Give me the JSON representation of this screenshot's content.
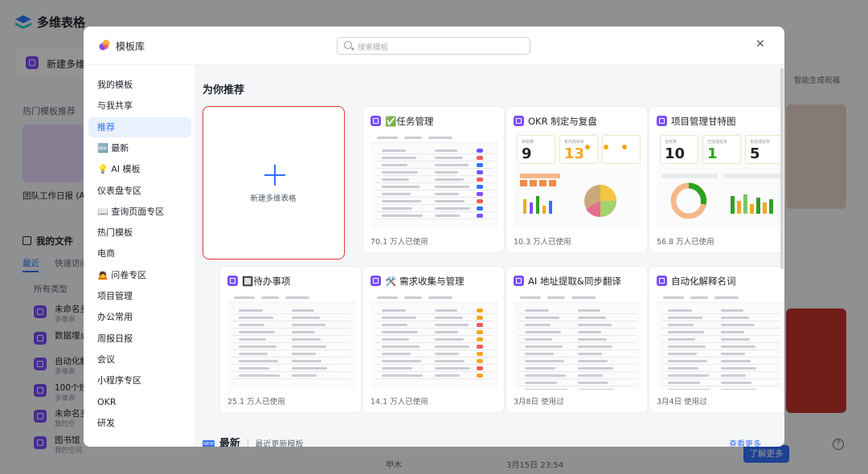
{
  "app": {
    "name": "多维表格",
    "new_table": "新建多维",
    "hot_templates": "热门模板推荐",
    "team_report": "团队工作日报 (A",
    "my_files": "我的文件",
    "tab_recent": "最近",
    "tab_quick": "快速访问",
    "filter_all_types": "所有类型",
    "files": [
      {
        "name": "未命名多",
        "sub": "多维表"
      },
      {
        "name": "数据埋点",
        "sub": ""
      },
      {
        "name": "自动化解",
        "sub": "多维表"
      },
      {
        "name": "100个短",
        "sub": "多维表"
      },
      {
        "name": "未命名多",
        "sub": "我的空"
      },
      {
        "name": "图书馆",
        "sub": "我的空间"
      }
    ],
    "right_link": "智能生成祝福",
    "bottom_owner": "甲木",
    "bottom_time": "3月15日 23:54",
    "learn_more": "了解更多"
  },
  "modal": {
    "title": "模板库",
    "search_placeholder": "搜索模板",
    "close_glyph": "✕",
    "nav": [
      {
        "label": "我的模板"
      },
      {
        "label": "与我共享"
      },
      {
        "label": "推荐",
        "active": true
      },
      {
        "label": "🆕 最新"
      },
      {
        "label": "💡 AI 模板"
      },
      {
        "label": "仪表盘专区"
      },
      {
        "label": "📖 查询页面专区"
      },
      {
        "label": "热门模板"
      },
      {
        "label": "电商"
      },
      {
        "label": "🙇 问卷专区"
      },
      {
        "label": "项目管理"
      },
      {
        "label": "办公常用"
      },
      {
        "label": "周报日报"
      },
      {
        "label": "会议"
      },
      {
        "label": "小程序专区"
      },
      {
        "label": "OKR"
      },
      {
        "label": "研发"
      }
    ],
    "section_title": "为你推荐",
    "new_card_label": "新建多维表格",
    "cards": [
      {
        "title": "✅任务管理",
        "footer": "70.1 万人已使用"
      },
      {
        "title": "OKR 制定与复盘",
        "footer": "10.3 万人已使用"
      },
      {
        "title": "项目管理甘特图",
        "footer": "56.8 万人已使用"
      },
      {
        "title": "🔲待办事项",
        "footer": "25.1 万人已使用"
      },
      {
        "title": "🛠️ 需求收集与管理",
        "footer": "14.1 万人已使用"
      },
      {
        "title": "AI 地址提取&同步翻译",
        "footer": "3月8日 使用过"
      },
      {
        "title": "自动化解释名词",
        "footer": "3月4日 使用过"
      }
    ],
    "okr_kpis": [
      {
        "label": "目标数",
        "value": "9",
        "color": "#1f2329"
      },
      {
        "label": "有风险目标",
        "value": "13",
        "color": "#f5a623"
      },
      {
        "label": "",
        "value": "",
        "color": "#1f2329"
      }
    ],
    "gantt_kpis": [
      {
        "label": "任务数",
        "value": "10",
        "color": "#1f2329"
      },
      {
        "label": "已完成任务",
        "value": "1",
        "color": "#2ea121"
      },
      {
        "label": "未完成任务",
        "value": "5",
        "color": "#1f2329"
      }
    ],
    "latest_icon": "NEW",
    "latest_title": "最新",
    "latest_sub": "最近更新模板",
    "see_more": "查看更多"
  }
}
